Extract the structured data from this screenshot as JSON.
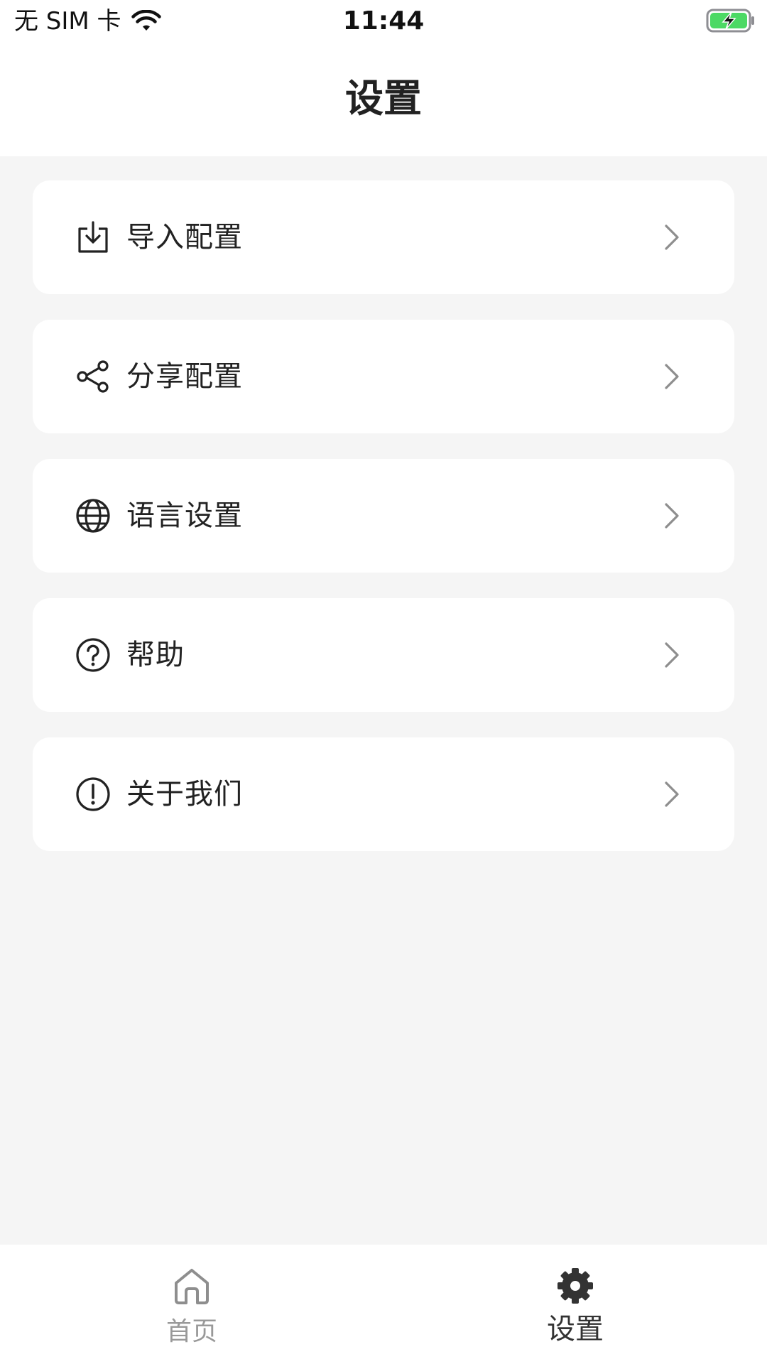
{
  "status_bar": {
    "carrier": "无 SIM 卡",
    "time": "11:44"
  },
  "nav": {
    "title": "设置"
  },
  "menu": {
    "items": [
      {
        "label": "导入配置",
        "icon": "import-icon"
      },
      {
        "label": "分享配置",
        "icon": "share-icon"
      },
      {
        "label": "语言设置",
        "icon": "globe-icon"
      },
      {
        "label": "帮助",
        "icon": "help-circle-icon"
      },
      {
        "label": "关于我们",
        "icon": "info-circle-icon"
      }
    ]
  },
  "tabbar": {
    "tabs": [
      {
        "label": "首页",
        "icon": "home-icon",
        "active": false
      },
      {
        "label": "设置",
        "icon": "gear-icon",
        "active": true
      }
    ]
  },
  "colors": {
    "background": "#f5f5f5",
    "card": "#ffffff",
    "text": "#222222",
    "inactive_tab": "#999999",
    "battery_green": "#4cd964"
  }
}
